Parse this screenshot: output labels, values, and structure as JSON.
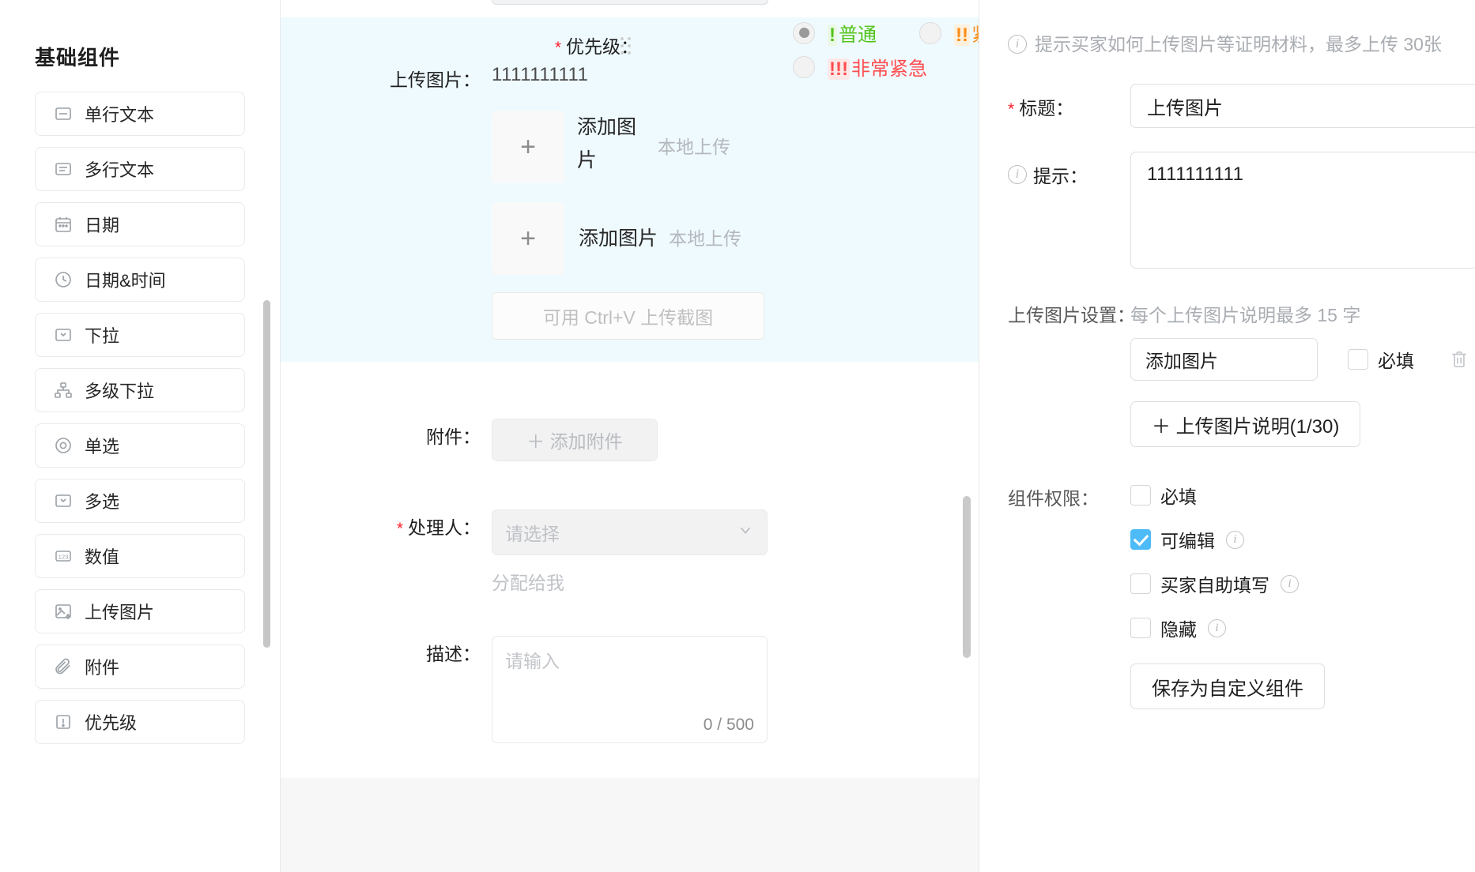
{
  "sidebar": {
    "title": "基础组件",
    "items": [
      {
        "label": "单行文本",
        "icon": "single-line-text-icon"
      },
      {
        "label": "多行文本",
        "icon": "multi-line-text-icon"
      },
      {
        "label": "日期",
        "icon": "calendar-icon"
      },
      {
        "label": "日期&时间",
        "icon": "clock-icon"
      },
      {
        "label": "下拉",
        "icon": "dropdown-icon"
      },
      {
        "label": "多级下拉",
        "icon": "cascader-icon"
      },
      {
        "label": "单选",
        "icon": "radio-icon"
      },
      {
        "label": "多选",
        "icon": "multi-select-icon"
      },
      {
        "label": "数值",
        "icon": "number-123-icon"
      },
      {
        "label": "上传图片",
        "icon": "image-upload-icon"
      },
      {
        "label": "附件",
        "icon": "paperclip-icon"
      },
      {
        "label": "优先级",
        "icon": "exclamation-box-icon"
      }
    ]
  },
  "canvas": {
    "upload": {
      "label": "上传图片：",
      "value": "1111111111",
      "add_plus": "+",
      "add_image_label": "添加图片",
      "local_upload_label": "本地上传",
      "add_image_label_2": "添加图片",
      "local_upload_label_2": "本地上传",
      "paste_hint": "可用 Ctrl+V 上传截图"
    },
    "attachment": {
      "label": "附件：",
      "button": "＋ 添加附件"
    },
    "handler": {
      "label": "处理人：",
      "placeholder": "请选择",
      "assign_to_me": "分配给我",
      "required": true
    },
    "description": {
      "label": "描述：",
      "placeholder": "请输入",
      "counter": "0 / 500"
    },
    "priority": {
      "label": "优先级：",
      "required": true,
      "options": [
        {
          "bang": "!",
          "text": "普通",
          "selected": true,
          "color": "#52c41a"
        },
        {
          "bang": "!!",
          "text": "紧急",
          "selected": false,
          "color": "#fa8c16"
        },
        {
          "bang": "!!!",
          "text": "非常紧急",
          "selected": false,
          "color": "#ff4d4f"
        }
      ],
      "actions": [
        {
          "name": "eye-off-icon"
        },
        {
          "name": "delete-circle-icon"
        }
      ]
    }
  },
  "inspector": {
    "hint": "提示买家如何上传图片等证明材料，最多上传 30张",
    "title_label": "标题：",
    "title_value": "上传图片",
    "tip_label": "提示：",
    "tip_value": "1111111111",
    "settings_label": "上传图片设置：",
    "settings_hint": "每个上传图片说明最多 15 字",
    "setting_item_value": "添加图片",
    "setting_item_required_label": "必填",
    "setting_item_required_checked": false,
    "add_caption_button": "＋ 上传图片说明(1/30)",
    "permission_label": "组件权限：",
    "permissions": [
      {
        "label": "必填",
        "checked": false,
        "info": false
      },
      {
        "label": "可编辑",
        "checked": true,
        "info": true
      },
      {
        "label": "买家自助填写",
        "checked": false,
        "info": true
      },
      {
        "label": "隐藏",
        "checked": false,
        "info": true
      }
    ],
    "save_button": "保存为自定义组件"
  },
  "colors": {
    "accent": "#4dbbf7",
    "selected_bg": "#effaff",
    "required_star": "#f5222d"
  }
}
